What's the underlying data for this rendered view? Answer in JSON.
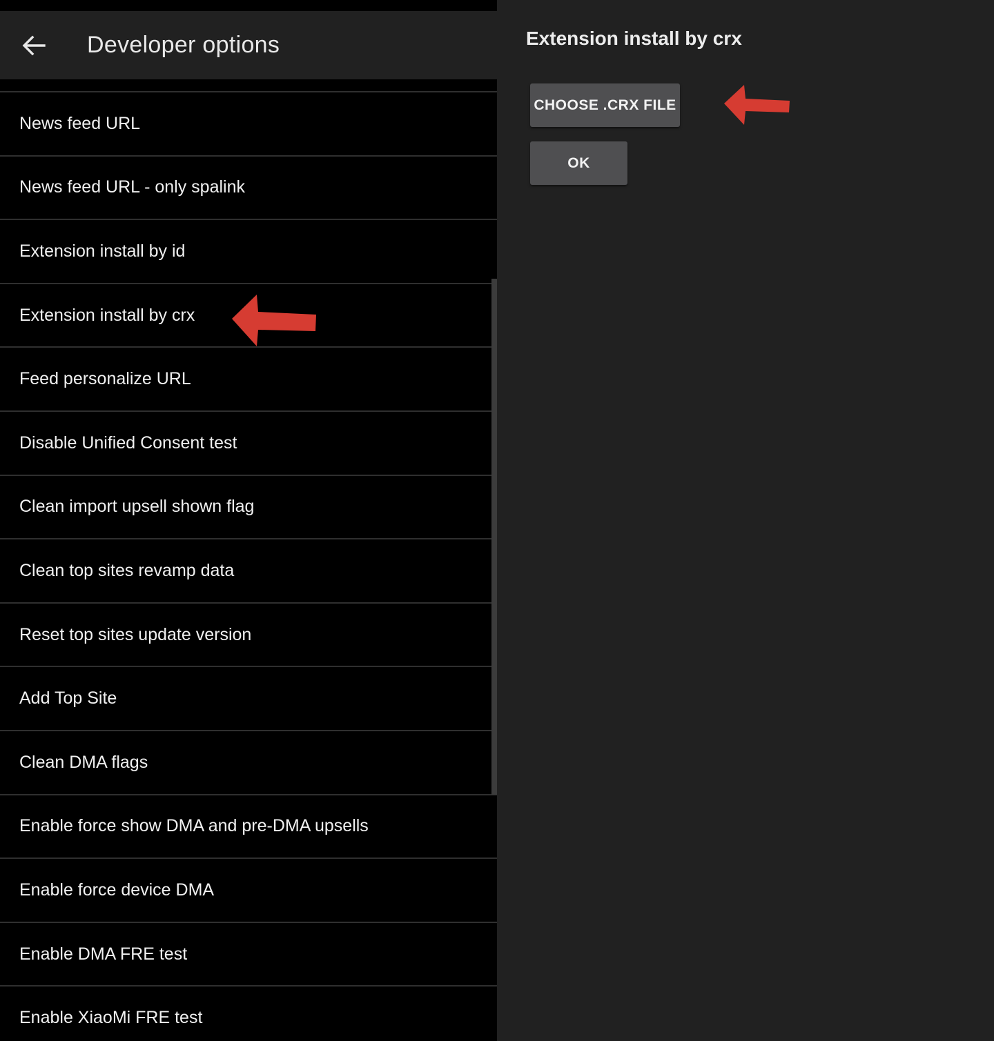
{
  "appbar": {
    "back_icon": "arrow-left-icon",
    "title": "Developer options"
  },
  "options": [
    {
      "label": "News feed URL"
    },
    {
      "label": "News feed URL - only spalink"
    },
    {
      "label": "Extension install by id"
    },
    {
      "label": "Extension install by crx"
    },
    {
      "label": "Feed personalize URL"
    },
    {
      "label": "Disable Unified Consent test"
    },
    {
      "label": "Clean import upsell shown flag"
    },
    {
      "label": "Clean top sites revamp data"
    },
    {
      "label": "Reset top sites update version"
    },
    {
      "label": "Add Top Site"
    },
    {
      "label": "Clean DMA flags"
    },
    {
      "label": "Enable force show DMA and pre-DMA upsells"
    },
    {
      "label": "Enable force device DMA"
    },
    {
      "label": "Enable DMA FRE test"
    },
    {
      "label": "Enable XiaoMi FRE test"
    }
  ],
  "dialog": {
    "title": "Extension install by crx",
    "choose_button": "CHOOSE .CRX FILE",
    "ok_button": "OK"
  },
  "annotations": {
    "arrow_icon": "red-arrow-icon",
    "arrow_color": "#d63c32"
  },
  "colors": {
    "list_bg": "#000000",
    "appbar_bg": "#212121",
    "dialog_bg": "#212121",
    "button_bg": "#4f4f51",
    "divider": "#2f2f2f"
  }
}
